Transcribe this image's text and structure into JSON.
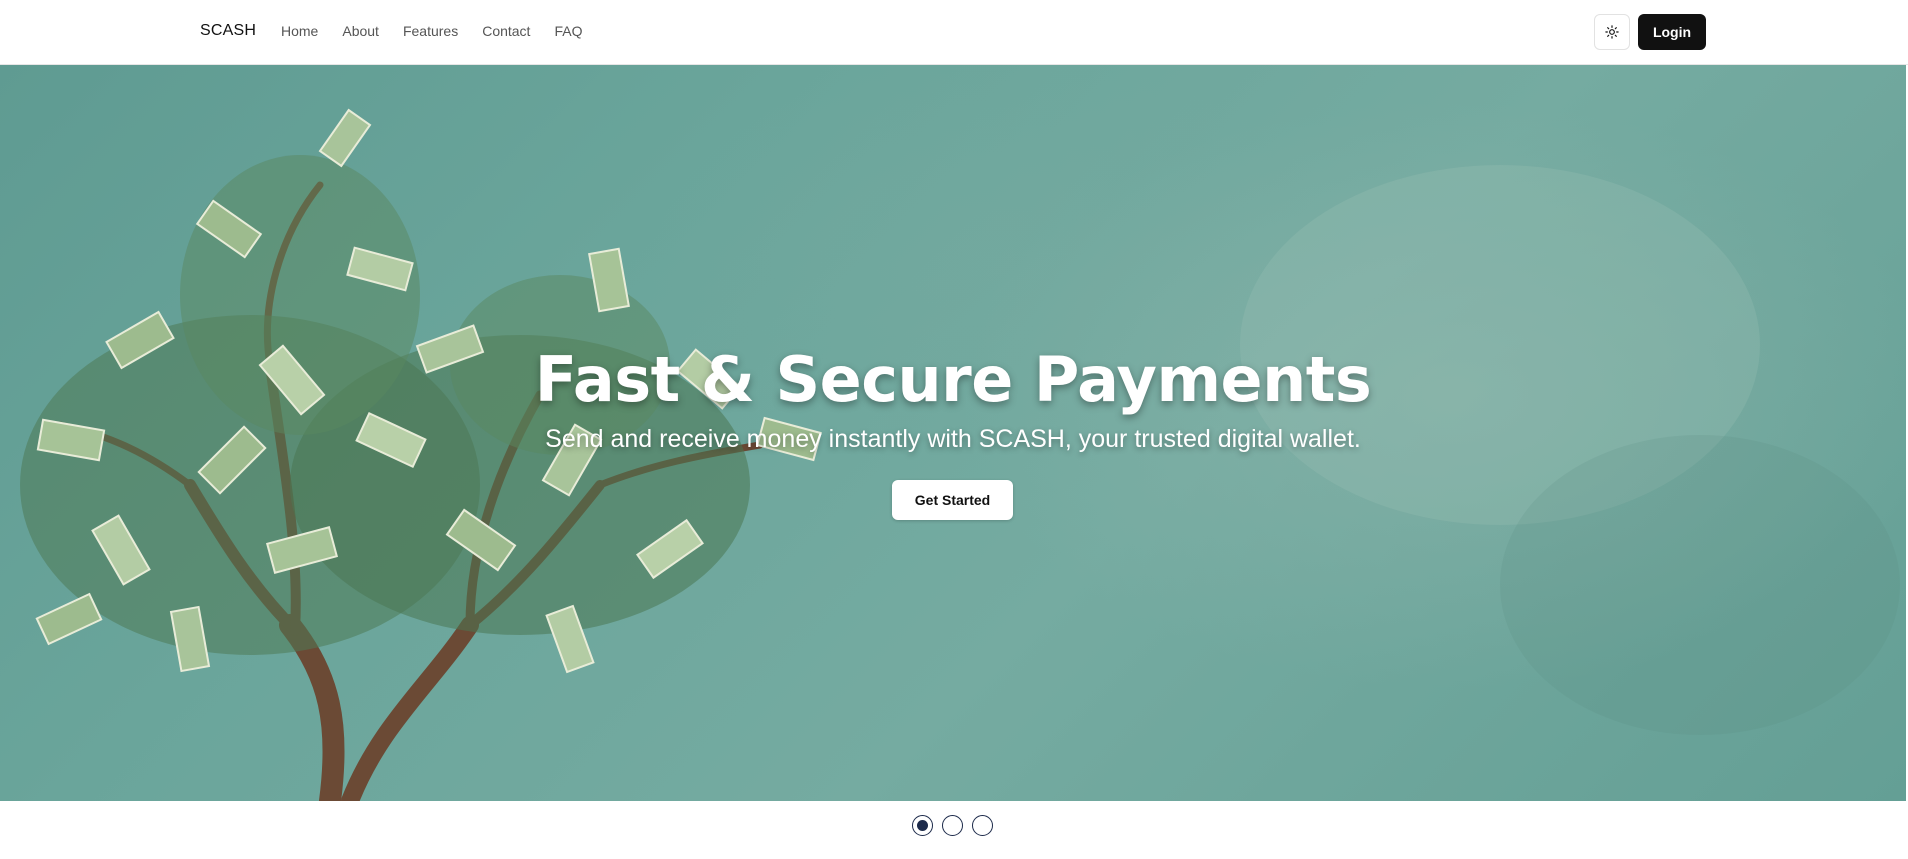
{
  "navbar": {
    "brand": "SCASH",
    "links": [
      "Home",
      "About",
      "Features",
      "Contact",
      "FAQ"
    ],
    "theme_toggle_icon": "sun-icon",
    "login_label": "Login"
  },
  "hero": {
    "title": "Fast & Secure Payments",
    "subtitle": "Send and receive money instantly with SCASH, your trusted digital wallet.",
    "cta_label": "Get Started",
    "background_color": "#6aa59b",
    "image_subject": "money-tree-illustration"
  },
  "carousel": {
    "slide_count": 3,
    "active_index": 0,
    "dot_color": "#1c2a4a"
  }
}
